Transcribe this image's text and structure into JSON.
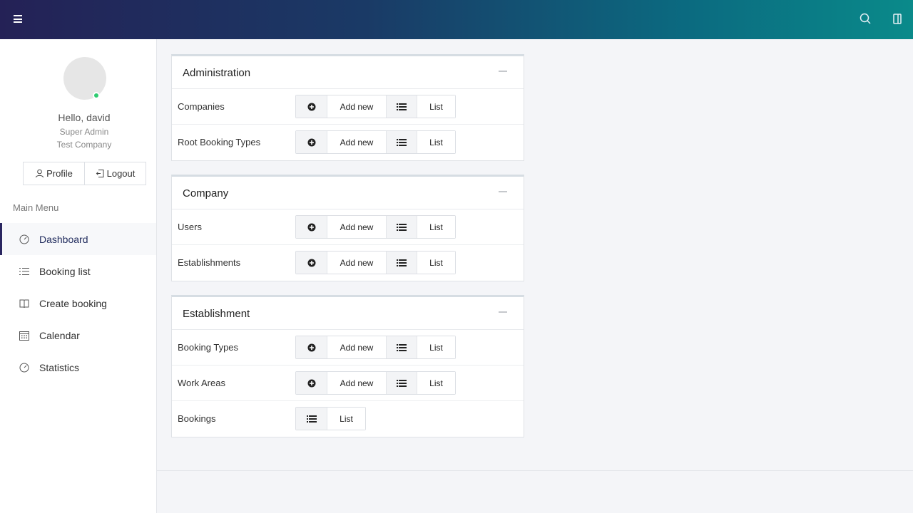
{
  "topbar": {
    "menu_icon": "hamburger-icon",
    "search_icon": "search-icon",
    "panel_icon": "sidebar-toggle-icon"
  },
  "user": {
    "greeting": "Hello, david",
    "role": "Super Admin",
    "company": "Test Company",
    "profile_label": "Profile",
    "logout_label": "Logout"
  },
  "menu": {
    "title": "Main Menu",
    "items": [
      {
        "label": "Dashboard",
        "icon": "gauge-icon"
      },
      {
        "label": "Booking list",
        "icon": "list-icon"
      },
      {
        "label": "Create booking",
        "icon": "book-icon"
      },
      {
        "label": "Calendar",
        "icon": "calendar-icon"
      },
      {
        "label": "Statistics",
        "icon": "gauge-icon"
      }
    ]
  },
  "cards": [
    {
      "title": "Administration",
      "rows": [
        {
          "label": "Companies",
          "add": "Add new",
          "list": "List"
        },
        {
          "label": "Root Booking Types",
          "add": "Add new",
          "list": "List"
        }
      ]
    },
    {
      "title": "Company",
      "rows": [
        {
          "label": "Users",
          "add": "Add new",
          "list": "List"
        },
        {
          "label": "Establishments",
          "add": "Add new",
          "list": "List"
        }
      ]
    },
    {
      "title": "Establishment",
      "rows": [
        {
          "label": "Booking Types",
          "add": "Add new",
          "list": "List"
        },
        {
          "label": "Work Areas",
          "add": "Add new",
          "list": "List"
        },
        {
          "label": "Bookings",
          "list": "List"
        }
      ]
    }
  ],
  "colors": {
    "topbar_start": "#242156",
    "topbar_end": "#0a8a8a",
    "active_accent": "#2a2660",
    "online_status": "#2ecc71"
  }
}
